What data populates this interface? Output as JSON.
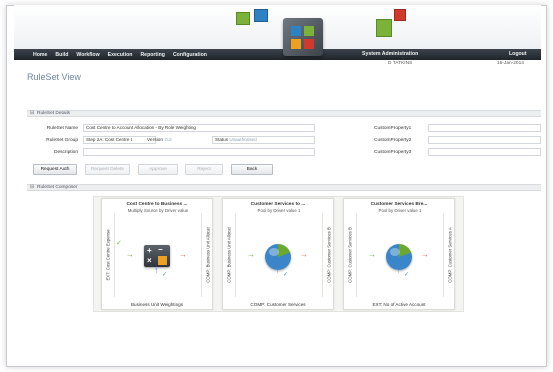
{
  "nav": {
    "items": [
      "Home",
      "Build",
      "Workflow",
      "Execution",
      "Reporting",
      "Configuration"
    ],
    "system_admin": "System Administration",
    "logout": "Logout"
  },
  "user": {
    "name": "D TATKINS",
    "date": "16-Jan-2014"
  },
  "page": {
    "title": "RuleSet View"
  },
  "details": {
    "section_label": "RuleSet Details",
    "name_label": "RuleSet Name",
    "name_value": "Cost Centre to Account Allocation - By Role Weighting",
    "group_label": "RuleSet Group",
    "group_value": "Step 2A: Cost Centre t",
    "version_label": "Version",
    "version_value": "0.2",
    "status_label": "Status",
    "status_value": "Unauthorised",
    "description_label": "Description",
    "description_value": "",
    "cp1_label": "CustomProperty1",
    "cp2_label": "CustomProperty2",
    "cp3_label": "CustomProperty3"
  },
  "buttons": {
    "request_auth": "Request Auth",
    "request_delete": "Request Delete",
    "approve": "Approve",
    "reject": "Reject",
    "back": "Back"
  },
  "composer": {
    "section_label": "RuleSet Composer",
    "nodes": [
      {
        "title": "Cost Centre to Business ...",
        "subtitle": "Multiply Source by Driver value",
        "left_label": "EXT: Cost Centre Expense",
        "right_label": "COMP: Business Unit Allocat",
        "bottom_label": "Business Unit Weightings",
        "icon": "calculator-icon"
      },
      {
        "title": "Customer Services to ...",
        "subtitle": "Pool by Driver value 1",
        "left_label": "COMP: Business Unit Allocat",
        "right_label": "COMP: Customer Services B",
        "bottom_label": "COMP: Customer Services",
        "icon": "pie-chart-icon"
      },
      {
        "title": "Customer Services Bre...",
        "subtitle": "Pool by Driver value 1",
        "left_label": "COMP: Customer Services B",
        "right_label": "COMP: Customer Services A",
        "bottom_label": "EXT: No of Active Account",
        "icon": "pie-chart-icon"
      }
    ]
  },
  "colors": {
    "nav_bg": "#2a3037",
    "title_blue": "#6e86a0",
    "accent_green": "#7ab23a",
    "accent_blue": "#2d82c4",
    "accent_red": "#d0392b",
    "accent_orange": "#f0a020"
  }
}
